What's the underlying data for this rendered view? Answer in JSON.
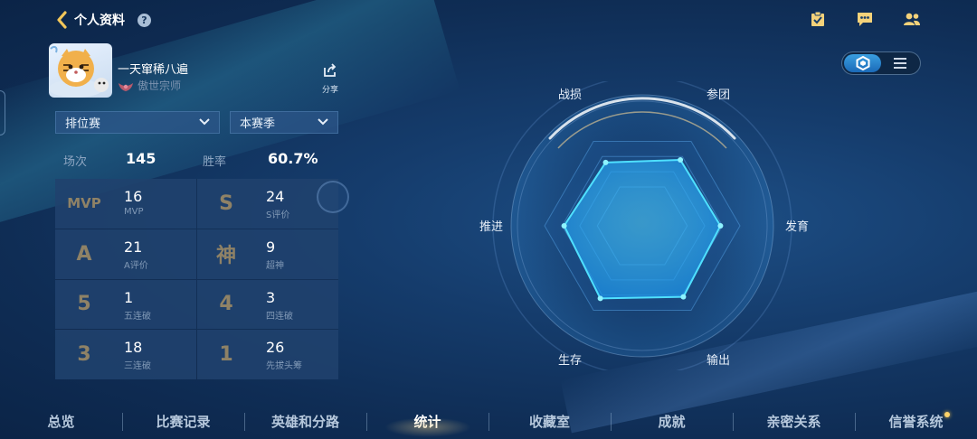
{
  "header": {
    "title": "个人资料",
    "help": "?"
  },
  "top_icons": [
    "task-icon",
    "chat-icon",
    "friends-icon"
  ],
  "profile": {
    "username": "一天窜稀八遍",
    "rank": "傲世宗师",
    "share_label": "分享"
  },
  "filters": {
    "mode": "排位赛",
    "season": "本赛季"
  },
  "summary": {
    "matches_label": "场次",
    "matches_value": "145",
    "winrate_label": "胜率",
    "winrate_value": "60.7%"
  },
  "stats": [
    {
      "icon": "MVP",
      "value": "16",
      "label": "MVP"
    },
    {
      "icon": "S",
      "value": "24",
      "label": "S评价"
    },
    {
      "icon": "A",
      "value": "21",
      "label": "A评价"
    },
    {
      "icon": "神",
      "value": "9",
      "label": "超神"
    },
    {
      "icon": "5",
      "value": "1",
      "label": "五连破"
    },
    {
      "icon": "4",
      "value": "3",
      "label": "四连破"
    },
    {
      "icon": "3",
      "value": "18",
      "label": "三连破"
    },
    {
      "icon": "1",
      "value": "26",
      "label": "先拔头筹"
    }
  ],
  "radar": {
    "labels": {
      "zhansun": "战损",
      "cantuan": "参团",
      "fayu": "发育",
      "shuchu": "输出",
      "shengcun": "生存",
      "tuijin": "推进"
    },
    "values": {
      "zhansun": 0.75,
      "cantuan": 0.78,
      "fayu": 0.8,
      "shuchu": 0.84,
      "shengcun": 0.86,
      "tuijin": 0.8
    }
  },
  "tabs": [
    "总览",
    "比赛记录",
    "英雄和分路",
    "统计",
    "收藏室",
    "成就",
    "亲密关系",
    "信誉系统"
  ],
  "active_tab": "统计",
  "colors": {
    "accent": "#2aa8ff",
    "gold": "#8f8266",
    "background": "#153c6c"
  }
}
